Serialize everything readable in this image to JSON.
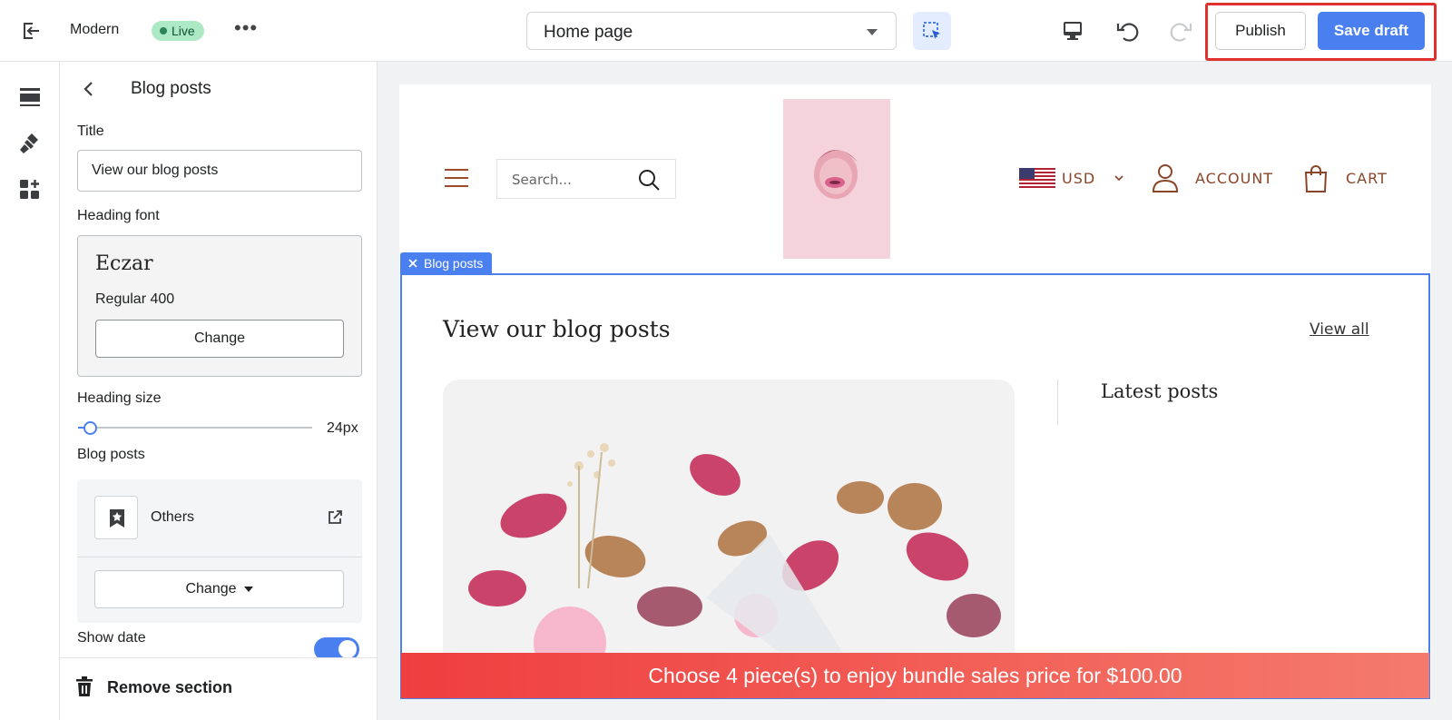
{
  "topbar": {
    "theme_name": "Modern",
    "live_badge": "Live",
    "more_label": "•••",
    "page_selector": "Home page",
    "publish_label": "Publish",
    "save_draft_label": "Save draft"
  },
  "rail": {
    "icons": [
      "sections-icon",
      "theme-settings-icon",
      "apps-icon"
    ]
  },
  "panel": {
    "title": "Blog posts",
    "title_label": "Title",
    "title_value": "View our blog posts",
    "heading_font_label": "Heading font",
    "font_name": "Eczar",
    "font_weight": "Regular 400",
    "font_change_label": "Change",
    "heading_size_label": "Heading size",
    "heading_size_value": "24px",
    "heading_size_fraction": 0.05,
    "blog_posts_label": "Blog posts",
    "blog_name": "Others",
    "blog_change_label": "Change",
    "show_date_label": "Show date",
    "show_date_on": true,
    "remove_section_label": "Remove section"
  },
  "preview": {
    "search_placeholder": "Search...",
    "currency": "USD",
    "account_label": "ACCOUNT",
    "cart_label": "CART",
    "section_tag": "Blog posts",
    "heading": "View our blog posts",
    "view_all": "View all",
    "latest_posts": "Latest posts",
    "promo_banner": "Choose 4 piece(s) to enjoy bundle sales price for $100.00"
  },
  "colors": {
    "accent": "#4a7ff0",
    "highlight_border": "#e0312c",
    "store_text": "#8a4528",
    "promo_start": "#ef3e3f",
    "promo_end": "#f47b6b"
  }
}
